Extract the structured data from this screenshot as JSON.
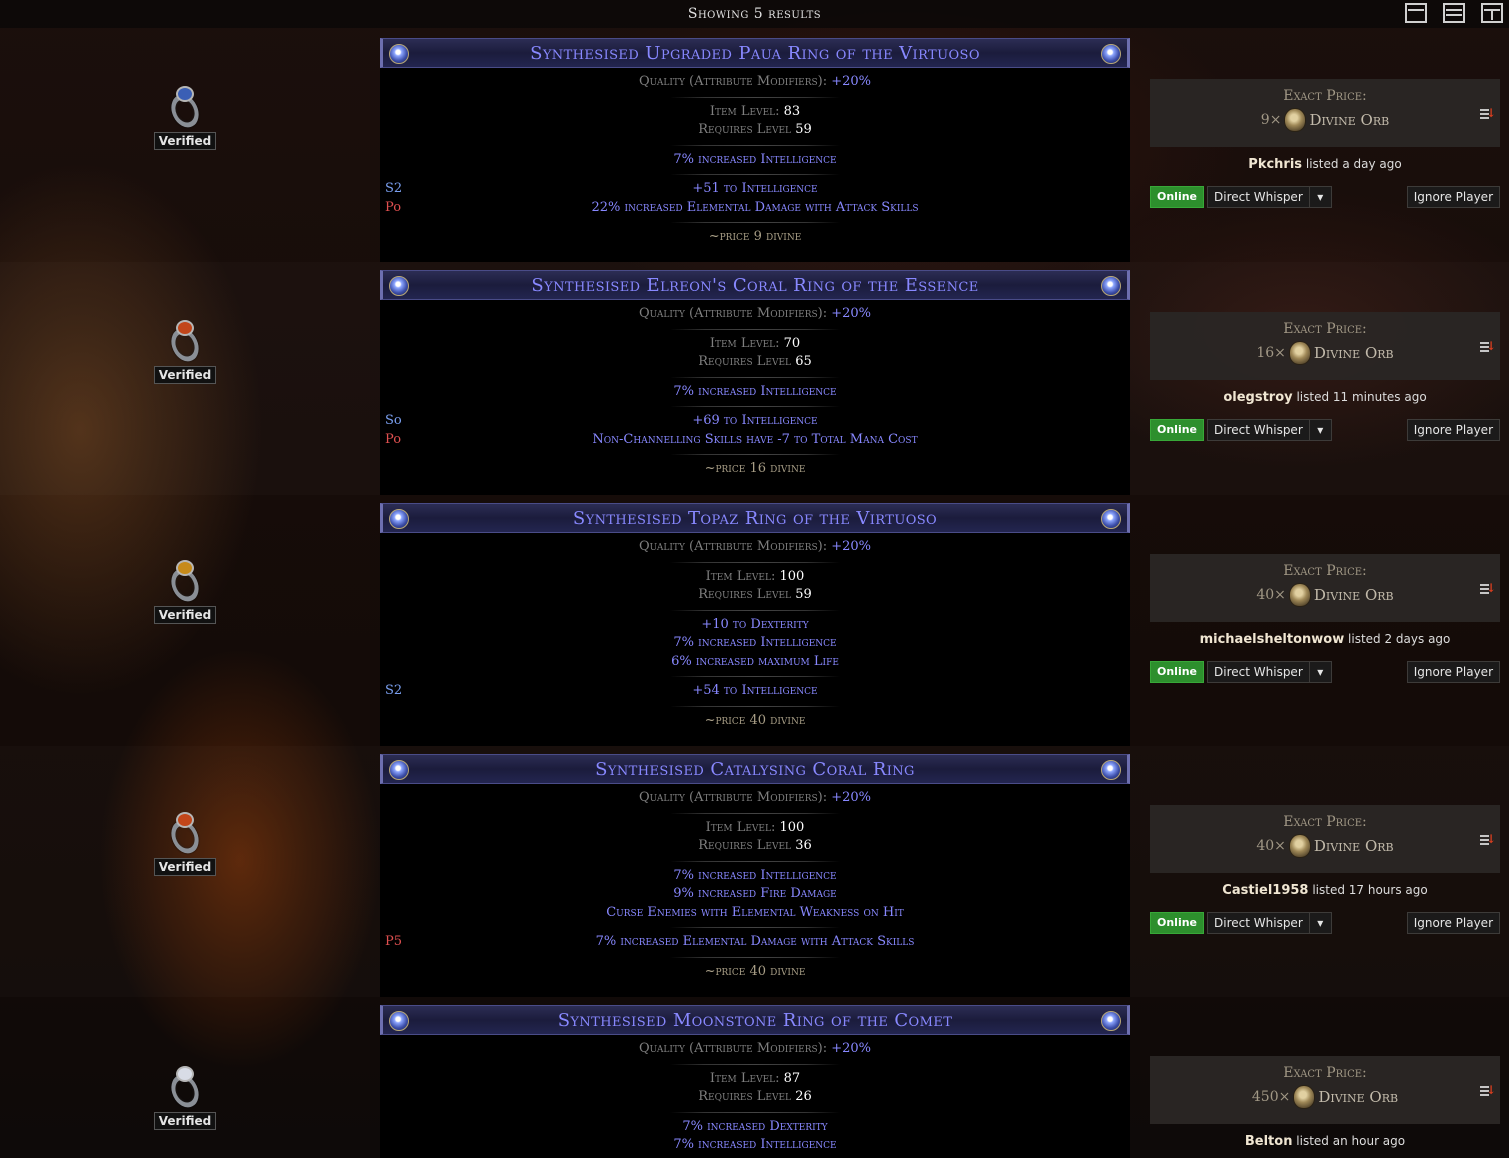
{
  "header": {
    "results_text": "Showing 5 results"
  },
  "view_icons": [
    "list-view-icon",
    "table-view-icon",
    "grid-view-icon"
  ],
  "colors": {
    "magic_text": "#8888ff",
    "online_green": "#2d8f2d",
    "background": "#130b08"
  },
  "results": [
    {
      "name": "Synthesised Upgraded Paua Ring of the Virtuoso",
      "quality_label": "Quality (Attribute Modifiers):",
      "quality_value": "+20%",
      "item_level_label": "Item Level:",
      "item_level": "83",
      "requires_label": "Requires Level",
      "requires_level": "59",
      "implicits": [
        "7% increased Intelligence"
      ],
      "explicits": [
        {
          "tag": "S2",
          "tag_color": "blue",
          "text": "+51 to Intelligence"
        },
        {
          "tag": "Po",
          "tag_color": "red",
          "text": "22% increased Elemental Damage with Attack Skills"
        }
      ],
      "note": "~price 9 divine",
      "verified": "Verified",
      "price_label": "Exact Price:",
      "price_amount": "9×",
      "currency": "Divine Orb",
      "seller": "Pkchris",
      "listed": "listed a day ago",
      "status": "Online",
      "whisper": "Direct Whisper",
      "ignore": "Ignore Player",
      "ring_gem_color": "#3b5fb5"
    },
    {
      "name": "Synthesised Elreon's Coral Ring of the Essence",
      "quality_label": "Quality (Attribute Modifiers):",
      "quality_value": "+20%",
      "item_level_label": "Item Level:",
      "item_level": "70",
      "requires_label": "Requires Level",
      "requires_level": "65",
      "implicits": [
        "7% increased Intelligence"
      ],
      "explicits": [
        {
          "tag": "So",
          "tag_color": "blue",
          "text": "+69 to Intelligence"
        },
        {
          "tag": "Po",
          "tag_color": "red",
          "text": "Non-Channelling Skills have -7 to Total Mana Cost"
        }
      ],
      "note": "~price 16 divine",
      "verified": "Verified",
      "price_label": "Exact Price:",
      "price_amount": "16×",
      "currency": "Divine Orb",
      "seller": "olegstroy",
      "listed": "listed 11 minutes ago",
      "status": "Online",
      "whisper": "Direct Whisper",
      "ignore": "Ignore Player",
      "ring_gem_color": "#c2461a"
    },
    {
      "name": "Synthesised Topaz Ring of the Virtuoso",
      "quality_label": "Quality (Attribute Modifiers):",
      "quality_value": "+20%",
      "item_level_label": "Item Level:",
      "item_level": "100",
      "requires_label": "Requires Level",
      "requires_level": "59",
      "implicits": [
        "+10 to Dexterity",
        "7% increased Intelligence",
        "6% increased maximum Life"
      ],
      "explicits": [
        {
          "tag": "S2",
          "tag_color": "blue",
          "text": "+54 to Intelligence"
        }
      ],
      "note": "~price 40 divine",
      "verified": "Verified",
      "price_label": "Exact Price:",
      "price_amount": "40×",
      "currency": "Divine Orb",
      "seller": "michaelsheltonwow",
      "listed": "listed 2 days ago",
      "status": "Online",
      "whisper": "Direct Whisper",
      "ignore": "Ignore Player",
      "ring_gem_color": "#c68a1a"
    },
    {
      "name": "Synthesised Catalysing Coral Ring",
      "quality_label": "Quality (Attribute Modifiers):",
      "quality_value": "+20%",
      "item_level_label": "Item Level:",
      "item_level": "100",
      "requires_label": "Requires Level",
      "requires_level": "36",
      "implicits": [
        "7% increased Intelligence",
        "9% increased Fire Damage",
        "Curse Enemies with Elemental Weakness on Hit"
      ],
      "explicits": [
        {
          "tag": "P5",
          "tag_color": "red",
          "text": "7% increased Elemental Damage with Attack Skills"
        }
      ],
      "note": "~price 40 divine",
      "verified": "Verified",
      "price_label": "Exact Price:",
      "price_amount": "40×",
      "currency": "Divine Orb",
      "seller": "Castiel1958",
      "listed": "listed 17 hours ago",
      "status": "Online",
      "whisper": "Direct Whisper",
      "ignore": "Ignore Player",
      "ring_gem_color": "#c2461a"
    },
    {
      "name": "Synthesised Moonstone Ring of the Comet",
      "quality_label": "Quality (Attribute Modifiers):",
      "quality_value": "+20%",
      "item_level_label": "Item Level:",
      "item_level": "87",
      "requires_label": "Requires Level",
      "requires_level": "26",
      "implicits": [
        "7% increased Dexterity",
        "7% increased Intelligence"
      ],
      "explicits": [],
      "note": "",
      "verified": "Verified",
      "price_label": "Exact Price:",
      "price_amount": "450×",
      "currency": "Divine Orb",
      "seller": "Belton",
      "listed": "listed an hour ago",
      "status": "",
      "whisper": "",
      "ignore": "",
      "ring_gem_color": "#d8dce6"
    }
  ]
}
